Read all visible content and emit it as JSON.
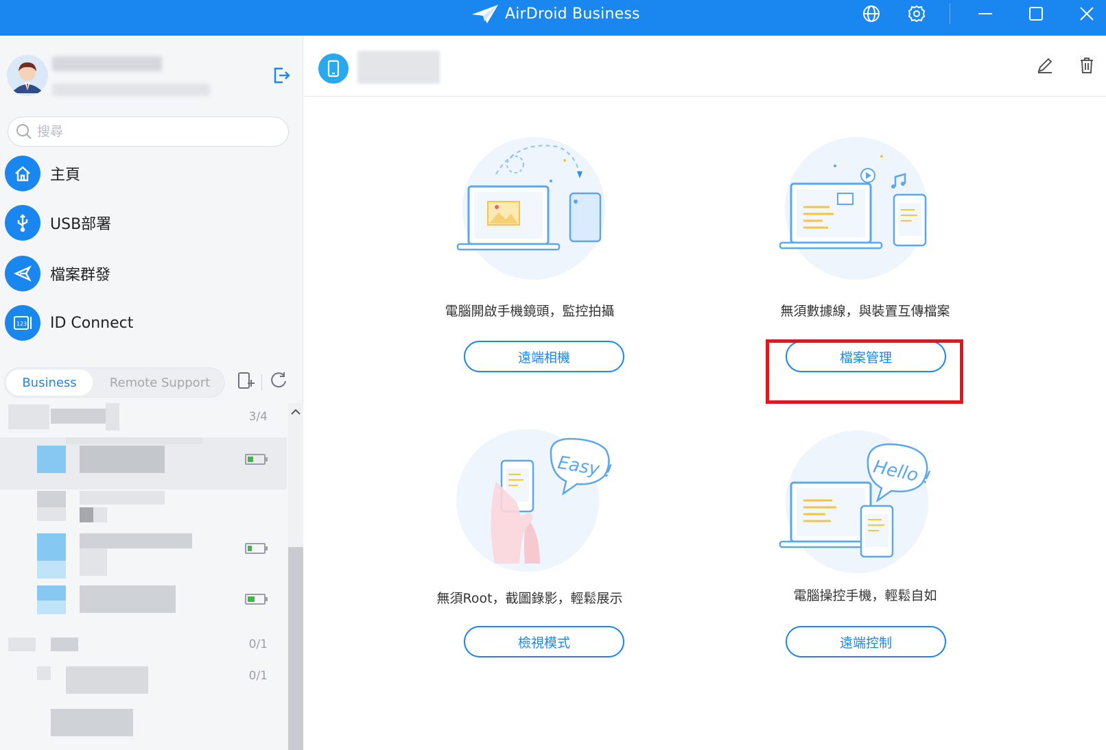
{
  "window": {
    "title": "AirDroid Business",
    "icons": [
      "globe-icon",
      "gear-icon",
      "minimize-icon",
      "maximize-icon",
      "close-icon"
    ]
  },
  "sidebar": {
    "search_placeholder": "搜尋",
    "nav_items": [
      {
        "label": "主頁",
        "icon": "home-icon"
      },
      {
        "label": "USB部署",
        "icon": "usb-icon"
      },
      {
        "label": "檔案群發",
        "icon": "send-icon"
      },
      {
        "label": "ID Connect",
        "icon": "id-connect-icon"
      }
    ],
    "tabs": {
      "business": "Business",
      "remote_support": "Remote Support",
      "active": "Business"
    },
    "device_groups": [
      {
        "count": "3/4"
      },
      {
        "count": "0/1"
      },
      {
        "count": "0/1"
      }
    ]
  },
  "main": {
    "features": [
      {
        "description": "電腦開啟手機鏡頭，監控拍攝",
        "button": "遠端相機",
        "icon": "camera-illustration"
      },
      {
        "description": "無須數據線，與裝置互傳檔案",
        "button": "檔案管理",
        "icon": "file-transfer-illustration"
      },
      {
        "description": "無須Root，截圖錄影，輕鬆展示",
        "button": "檢視模式",
        "icon": "view-mode-illustration"
      },
      {
        "description": "電腦操控手機，輕鬆自如",
        "button": "遠端控制",
        "icon": "remote-control-illustration"
      }
    ],
    "highlight_color": "#e8141a"
  },
  "colors": {
    "accent": "#1a86f0",
    "titlebar": "#1a86f0",
    "sidebar_bg": "#f5f6f8"
  }
}
